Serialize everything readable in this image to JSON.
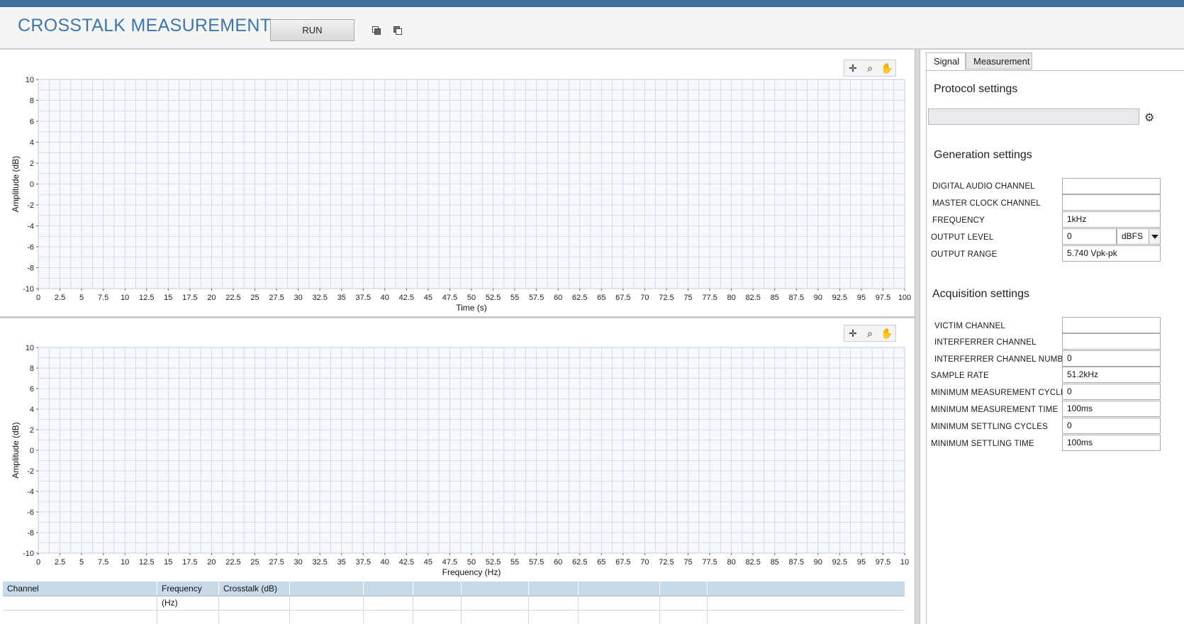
{
  "app": {
    "title": "CROSSTALK MEASUREMENT",
    "run_label": "RUN"
  },
  "graph_top": {
    "ylabel": "Amplitude (dB)",
    "xlabel": "Time (s)",
    "yticks": [
      "10",
      "8",
      "6",
      "4",
      "2",
      "0",
      "-2",
      "-4",
      "-6",
      "-8",
      "-10"
    ],
    "xticks": [
      "0",
      "2.5",
      "5",
      "7.5",
      "10",
      "12.5",
      "15",
      "17.5",
      "20",
      "22.5",
      "25",
      "27.5",
      "30",
      "32.5",
      "35",
      "37.5",
      "40",
      "42.5",
      "45",
      "47.5",
      "50",
      "52.5",
      "55",
      "57.5",
      "60",
      "62.5",
      "65",
      "67.5",
      "70",
      "72.5",
      "75",
      "77.5",
      "80",
      "82.5",
      "85",
      "87.5",
      "90",
      "92.5",
      "95",
      "97.5",
      "100"
    ]
  },
  "graph_bottom": {
    "ylabel": "Amplitude (dB)",
    "xlabel": "Frequency (Hz)",
    "yticks": [
      "10",
      "8",
      "6",
      "4",
      "2",
      "0",
      "-2",
      "-4",
      "-6",
      "-8",
      "-10"
    ],
    "xticks": [
      "0",
      "2.5",
      "5",
      "7.5",
      "10",
      "12.5",
      "15",
      "17.5",
      "20",
      "22.5",
      "25",
      "27.5",
      "30",
      "32.5",
      "35",
      "37.5",
      "40",
      "42.5",
      "45",
      "47.5",
      "50",
      "52.5",
      "55",
      "57.5",
      "60",
      "62.5",
      "65",
      "67.5",
      "70",
      "72.5",
      "75",
      "77.5",
      "80",
      "82.5",
      "85",
      "87.5",
      "90",
      "92.5",
      "95",
      "97.5",
      "10"
    ]
  },
  "graph_tools": [
    "cursor-tool-icon",
    "zoom-tool-icon",
    "pan-hand-icon"
  ],
  "results_table": {
    "columns": [
      "Channel",
      "Frequency (Hz)",
      "Crosstalk (dB)",
      "",
      "",
      "",
      "",
      "",
      "",
      "",
      ""
    ]
  },
  "tabs": [
    {
      "label": "Signal",
      "active": true
    },
    {
      "label": "Measurement",
      "active": false
    }
  ],
  "protocol": {
    "title": "Protocol settings",
    "value": ""
  },
  "generation": {
    "title": "Generation settings",
    "digital_audio_channel_label": "DIGITAL AUDIO CHANNEL",
    "digital_audio_channel_value": "",
    "master_clock_channel_label": "MASTER CLOCK CHANNEL",
    "master_clock_channel_value": "",
    "frequency_label": "FREQUENCY",
    "frequency_value": "1kHz",
    "output_level_label": "OUTPUT LEVEL",
    "output_level_value": "0",
    "output_level_unit": "dBFS",
    "output_range_label": "OUTPUT RANGE",
    "output_range_value": "5.740 Vpk-pk"
  },
  "acquisition": {
    "title": "Acquisition settings",
    "victim_channel_label": "VICTIM CHANNEL",
    "victim_channel_value": "",
    "interferrer_channel_label": "INTERFERRER CHANNEL",
    "interferrer_channel_value": "",
    "interferrer_channel_number_label": "INTERFERRER CHANNEL NUMBER",
    "interferrer_channel_number_value": "0",
    "sample_rate_label": "SAMPLE RATE",
    "sample_rate_value": "51.2kHz",
    "min_meas_cycles_label": "MINIMUM MEASUREMENT CYCLES",
    "min_meas_cycles_value": "0",
    "min_meas_time_label": "MINIMUM MEASUREMENT TIME",
    "min_meas_time_value": "100ms",
    "min_settling_cycles_label": "MINIMUM SETTLING CYCLES",
    "min_settling_cycles_value": "0",
    "min_settling_time_label": "MINIMUM SETTLING TIME",
    "min_settling_time_value": "100ms"
  },
  "colors": {
    "accent": "#3f76a6",
    "grid": "#c9d2ea",
    "plot_bg": "#f6f8fb",
    "table_header": "#c8d9ea"
  }
}
